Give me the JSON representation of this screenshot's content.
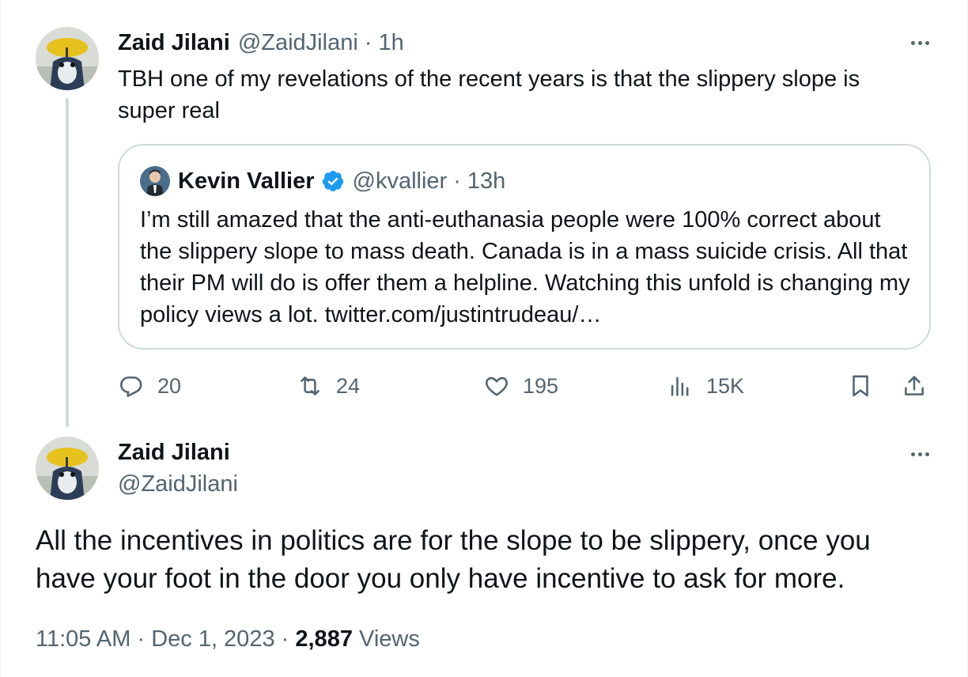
{
  "parent_tweet": {
    "author_name": "Zaid Jilani",
    "author_handle": "@ZaidJilani",
    "separator": "·",
    "time_ago": "1h",
    "text": "TBH one of my revelations of the recent years is that the slippery slope is super real",
    "more_icon": "ellipsis-icon",
    "quoted_tweet": {
      "author_name": "Kevin Vallier",
      "verified": true,
      "verified_color": "#1d9bf0",
      "author_handle": "@kvallier",
      "separator": "·",
      "time_ago": "13h",
      "text": "I’m still amazed that the anti-euthanasia people were 100% correct about the slippery slope to mass death. Canada is in a mass suicide crisis. All that their PM will do is offer them a helpline. Watching this unfold is changing my policy views a lot.",
      "link_text": "twitter.com/justintrudeau/…"
    },
    "actions": {
      "replies": "20",
      "retweets": "24",
      "likes": "195",
      "views": "15K"
    }
  },
  "main_tweet": {
    "author_name": "Zaid Jilani",
    "author_handle": "@ZaidJilani",
    "text": "All the incentives in politics are for the slope to be slippery, once you have your foot in the door you only have incentive to ask for more.",
    "time": "11:05 AM",
    "separator": "·",
    "date": "Dec 1, 2023",
    "view_count": "2,887",
    "views_label": "Views"
  },
  "colors": {
    "text_primary": "#0f1419",
    "text_secondary": "#536471",
    "border": "#cfd9de",
    "verified": "#1d9bf0"
  }
}
